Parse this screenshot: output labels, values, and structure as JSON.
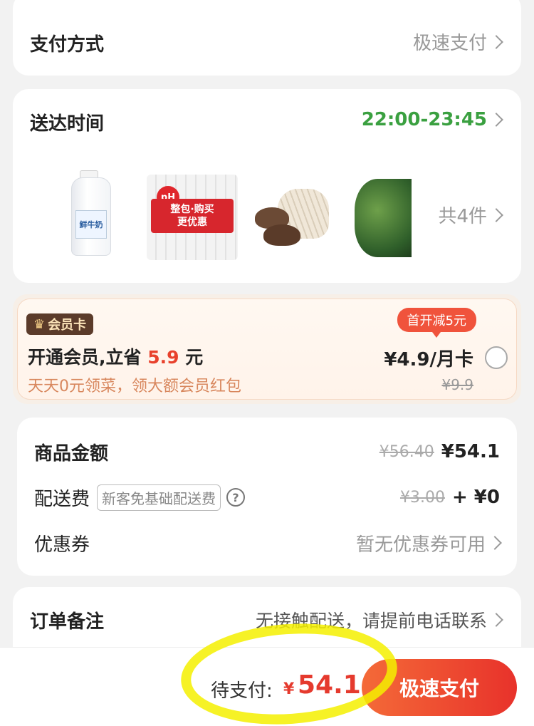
{
  "payment": {
    "label": "支付方式",
    "value": "极速支付"
  },
  "delivery": {
    "label": "送达时间",
    "time": "22:00-23:45",
    "count": "共4件",
    "products": [
      {
        "name": "milk",
        "label": "鲜牛奶"
      },
      {
        "name": "water",
        "label_top": "整包·购买",
        "label_bottom": "更优惠",
        "ph": "pH"
      },
      {
        "name": "mushroom"
      },
      {
        "name": "greens"
      }
    ]
  },
  "member": {
    "badge": "会员卡",
    "title_prefix": "开通会员,立省",
    "save_amount": "5.9",
    "title_suffix": "元",
    "subtitle": "天天0元领菜，领大额会员红包",
    "first_tag": "首开减5元",
    "price": "¥4.9/月卡",
    "original_price": "¥9.9"
  },
  "price": {
    "goods_label": "商品金额",
    "goods_original": "¥56.40",
    "goods_now": "¥54.1",
    "ship_label": "配送费",
    "ship_tag": "新客免基础配送费",
    "ship_original": "¥3.00",
    "ship_now": "+ ¥0",
    "coupon_label": "优惠券",
    "coupon_value": "暂无优惠券可用"
  },
  "note": {
    "label": "订单备注",
    "value": "无接触配送，请提前电话联系"
  },
  "bottom": {
    "pay_label": "待支付:",
    "currency": "¥",
    "amount": "54.1",
    "pay_button": "极速支付"
  },
  "colors": {
    "accent_red": "#e53a2e",
    "time_green": "#3aa040",
    "highlight_yellow": "#f4f000"
  }
}
